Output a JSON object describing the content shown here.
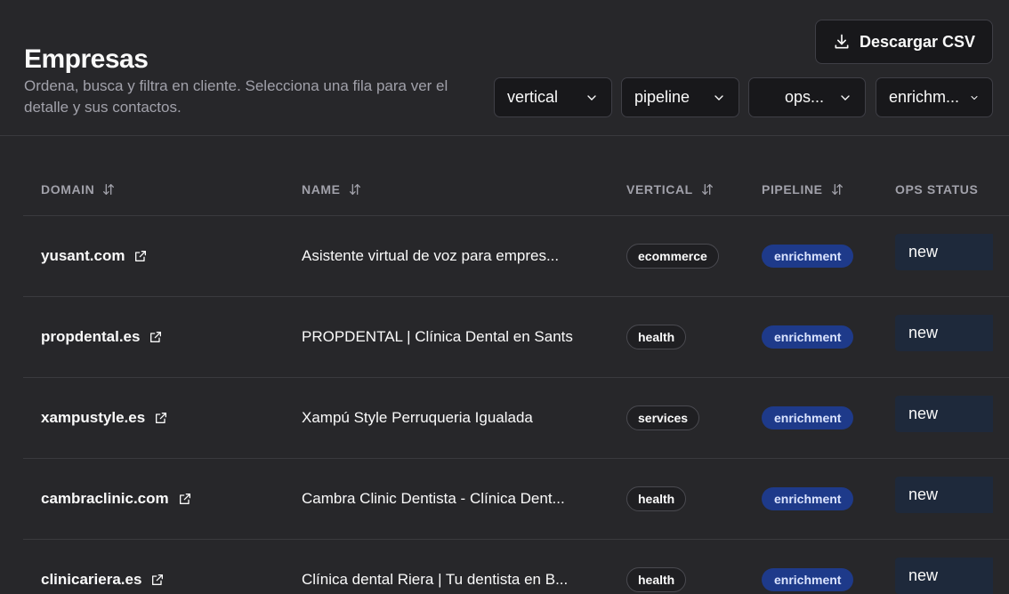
{
  "header": {
    "title": "Empresas",
    "subtitle": "Ordena, busca y filtra en cliente. Selecciona una fila para ver el detalle y sus contactos.",
    "csv_label": "Descargar CSV"
  },
  "filters": [
    "vertical",
    "pipeline",
    "ops...",
    "enrichm..."
  ],
  "table": {
    "columns": [
      "DOMAIN",
      "NAME",
      "VERTICAL",
      "PIPELINE",
      "OPS STATUS"
    ],
    "rows": [
      {
        "domain": "yusant.com",
        "name": "Asistente virtual de voz para empres...",
        "vertical": "ecommerce",
        "pipeline": "enrichment",
        "ops": "new"
      },
      {
        "domain": "propdental.es",
        "name": "PROPDENTAL | Clínica Dental en Sants",
        "vertical": "health",
        "pipeline": "enrichment",
        "ops": "new"
      },
      {
        "domain": "xampustyle.es",
        "name": "Xampú Style Perruqueria Igualada",
        "vertical": "services",
        "pipeline": "enrichment",
        "ops": "new"
      },
      {
        "domain": "cambraclinic.com",
        "name": "Cambra Clinic Dentista - Clínica Dent...",
        "vertical": "health",
        "pipeline": "enrichment",
        "ops": "new"
      },
      {
        "domain": "clinicariera.es",
        "name": "Clínica dental Riera | Tu dentista en B...",
        "vertical": "health",
        "pipeline": "enrichment",
        "ops": "new"
      }
    ]
  },
  "icons": {
    "download": "download-icon",
    "chevron": "chevron-down-icon",
    "sort": "sort-icon",
    "external": "external-link-icon"
  },
  "colors": {
    "background": "#27272a",
    "surface": "#18181b",
    "pipeline_badge": "#1e3a8a",
    "ops_cell": "#1e293b",
    "muted_text": "#a1a1aa"
  }
}
